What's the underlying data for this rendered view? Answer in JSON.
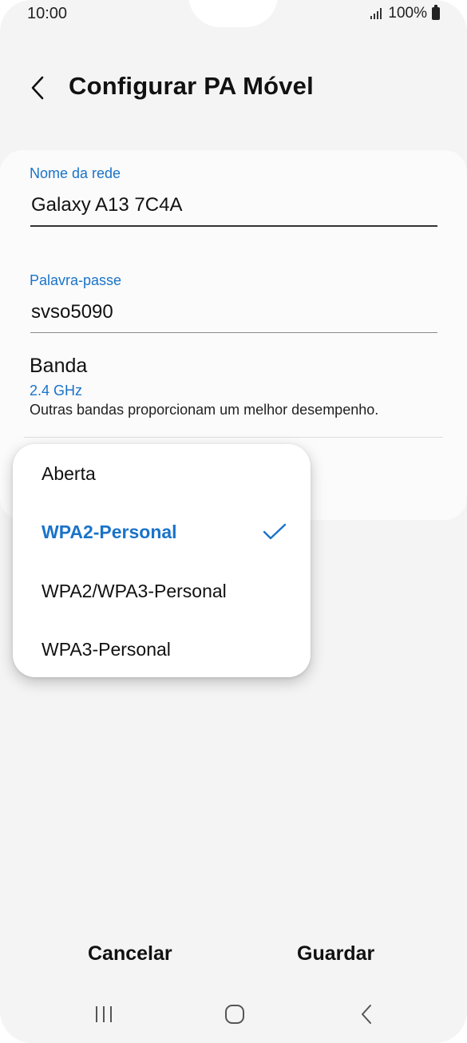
{
  "status_bar": {
    "time": "10:00",
    "battery": "100%"
  },
  "header": {
    "title": "Configurar PA Móvel"
  },
  "network_name": {
    "label": "Nome da rede",
    "value": "Galaxy A13 7C4A"
  },
  "password": {
    "label": "Palavra-passe",
    "value": "svso5090"
  },
  "band": {
    "title": "Banda",
    "value": "2.4 GHz",
    "description": "Outras bandas proporcionam um melhor desempenho."
  },
  "security_popup": {
    "selected": "WPA2-Personal",
    "options": [
      "Aberta",
      "WPA2-Personal",
      "WPA2/WPA3-Personal",
      "WPA3-Personal"
    ]
  },
  "buttons": {
    "cancel": "Cancelar",
    "save": "Guardar"
  },
  "colors": {
    "accent": "#1a73c9",
    "background": "#f4f4f4",
    "card": "#fbfbfb"
  },
  "icons": {
    "back": "chevron-left-icon",
    "check": "check-icon",
    "nav_recents": "recents-icon",
    "nav_home": "home-icon",
    "nav_back": "back-icon"
  }
}
